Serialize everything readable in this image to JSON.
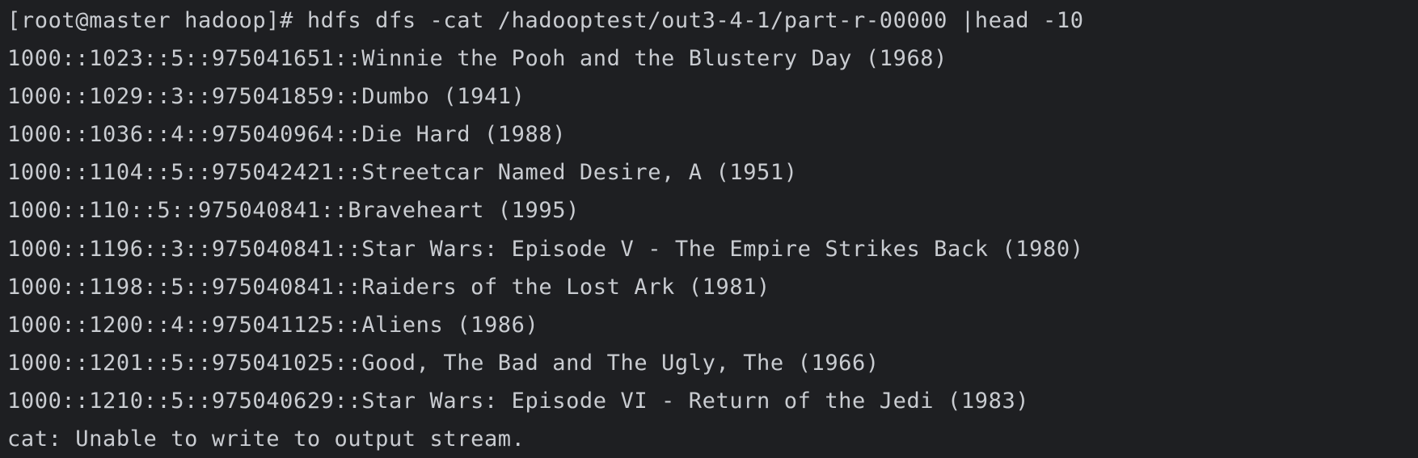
{
  "terminal": {
    "prompt": "[root@master hadoop]# ",
    "command": "hdfs dfs -cat /hadooptest/out3-4-1/part-r-00000 |head -10",
    "output": [
      "1000::1023::5::975041651::Winnie the Pooh and the Blustery Day (1968)",
      "1000::1029::3::975041859::Dumbo (1941)",
      "1000::1036::4::975040964::Die Hard (1988)",
      "1000::1104::5::975042421::Streetcar Named Desire, A (1951)",
      "1000::110::5::975040841::Braveheart (1995)",
      "1000::1196::3::975040841::Star Wars: Episode V - The Empire Strikes Back (1980)",
      "1000::1198::5::975040841::Raiders of the Lost Ark (1981)",
      "1000::1200::4::975041125::Aliens (1986)",
      "1000::1201::5::975041025::Good, The Bad and The Ugly, The (1966)",
      "1000::1210::5::975040629::Star Wars: Episode VI - Return of the Jedi (1983)"
    ],
    "error": "cat: Unable to write to output stream."
  },
  "colors": {
    "background": "#1e1f22",
    "text": "#c9ccd1"
  }
}
